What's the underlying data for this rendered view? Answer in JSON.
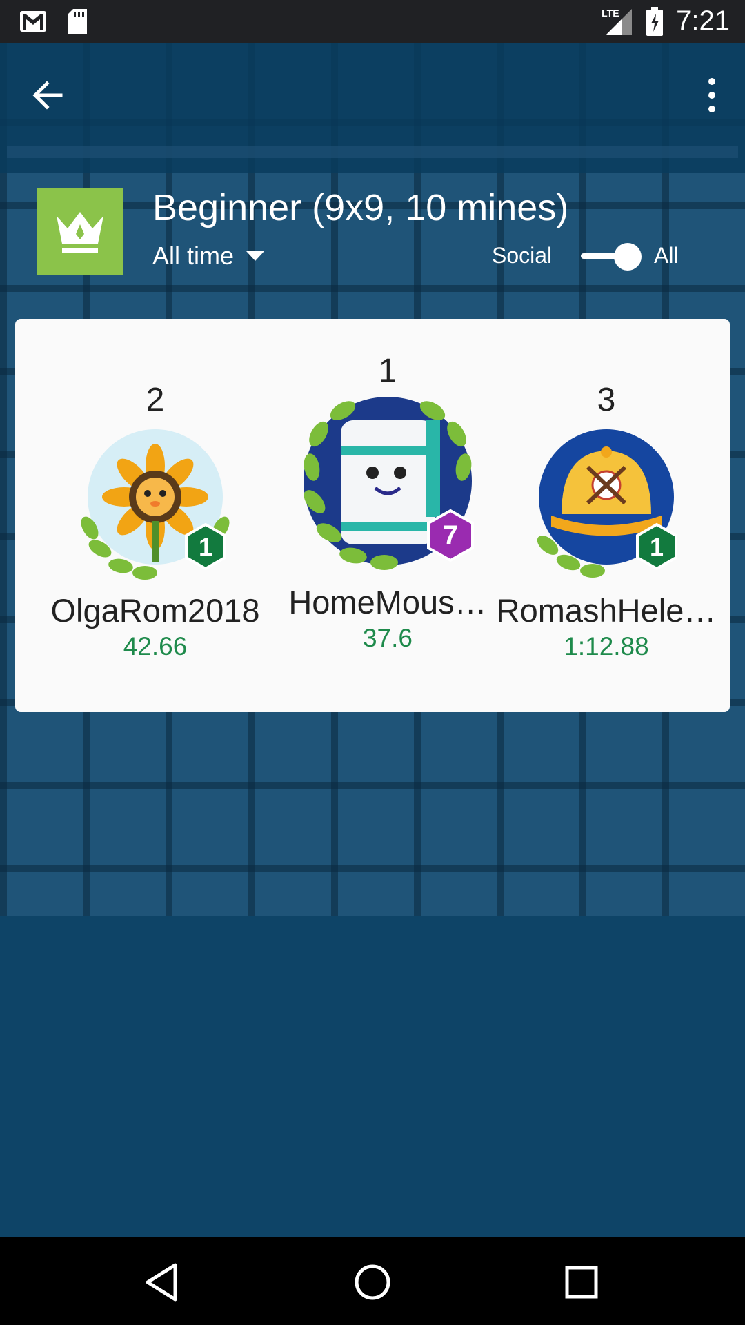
{
  "status_bar": {
    "time": "7:21",
    "network_label": "LTE",
    "icons": [
      "gmail-icon",
      "sd-card-icon",
      "signal-icon",
      "battery-charging-icon"
    ]
  },
  "app_bar": {
    "back_icon": "arrow-back-icon",
    "menu_icon": "more-vert-icon"
  },
  "header": {
    "difficulty_icon": "crown-icon",
    "title": "Beginner (9x9, 10 mines)",
    "time_filter": "All time",
    "toggle_left": "Social",
    "toggle_right": "All",
    "toggle_state": "All"
  },
  "leaderboard": [
    {
      "rank": "2",
      "name": "OlgaRom2018",
      "score": "42.66",
      "level": "1",
      "avatar": "sunflower-avatar",
      "badge_color": "#127a3e"
    },
    {
      "rank": "1",
      "name": "HomeMous…",
      "score": "37.6",
      "level": "7",
      "avatar": "robot-avatar",
      "badge_color": "#9a2bb0"
    },
    {
      "rank": "3",
      "name": "RomashHele…",
      "score": "1:12.88",
      "level": "1",
      "avatar": "baseball-cap-avatar",
      "badge_color": "#127a3e"
    }
  ],
  "nav_bar": {
    "icons": [
      "back-triangle-icon",
      "home-circle-icon",
      "recents-square-icon"
    ]
  },
  "colors": {
    "accent_green": "#8bc34a",
    "score_green": "#1e8a4b",
    "background": "#0e4467"
  }
}
